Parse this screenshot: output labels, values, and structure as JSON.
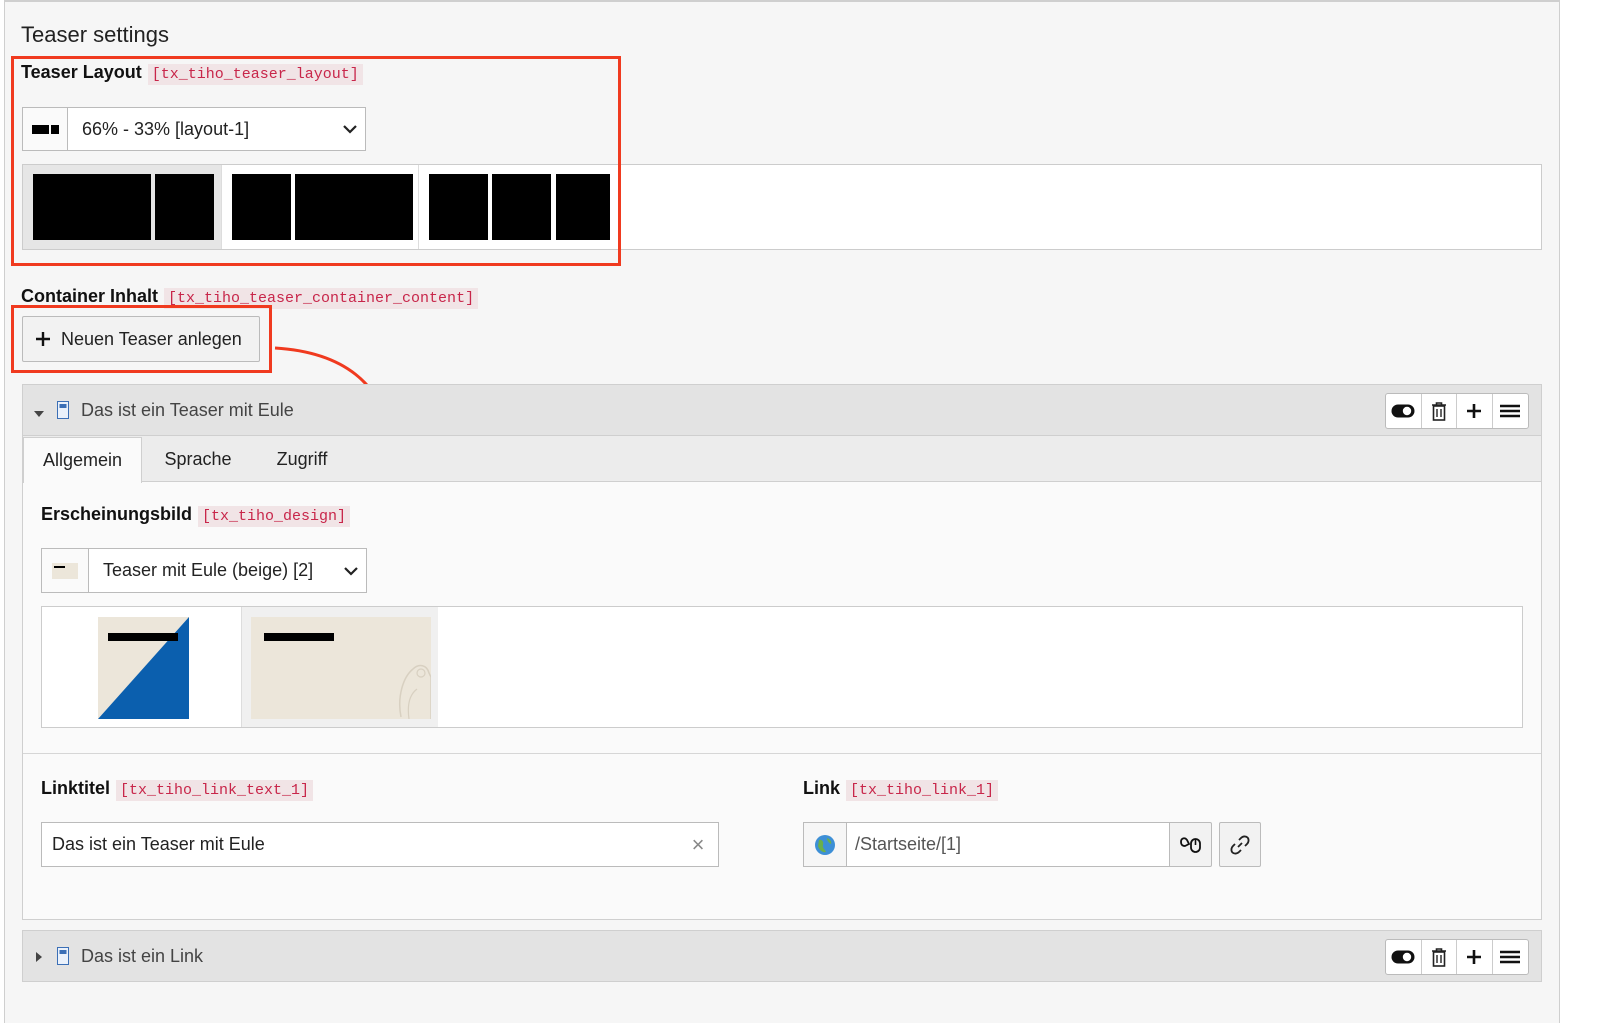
{
  "section": {
    "title": "Teaser settings"
  },
  "teaser_layout": {
    "label": "Teaser Layout",
    "code": "[tx_tiho_teaser_layout]",
    "selected": "66% - 33% [layout-1]",
    "icon": "layout-icon",
    "options": [
      "66% - 33%",
      "33% - 66%",
      "33% - 33% - 33%"
    ]
  },
  "container": {
    "label": "Container Inhalt",
    "code": "[tx_tiho_teaser_container_content]",
    "new_button": "Neuen Teaser anlegen"
  },
  "record1": {
    "title": "Das ist ein Teaser mit Eule",
    "tabs": [
      "Allgemein",
      "Sprache",
      "Zugriff"
    ],
    "active_tab": "Allgemein",
    "design": {
      "label": "Erscheinungsbild",
      "code": "[tx_tiho_design]",
      "selected": "Teaser mit Eule (beige) [2]"
    },
    "link_text": {
      "label": "Linktitel",
      "code": "[tx_tiho_link_text_1]",
      "value": "Das ist ein Teaser mit Eule",
      "clear": "×"
    },
    "link": {
      "label": "Link",
      "code": "[tx_tiho_link_1]",
      "value": "/Startseite/[1]"
    }
  },
  "record2": {
    "title": "Das ist ein Link"
  },
  "colors": {
    "annotation": "#f03a1f",
    "code_text": "#c8264a",
    "blue": "#0b5fae",
    "beige": "#ece6da"
  }
}
